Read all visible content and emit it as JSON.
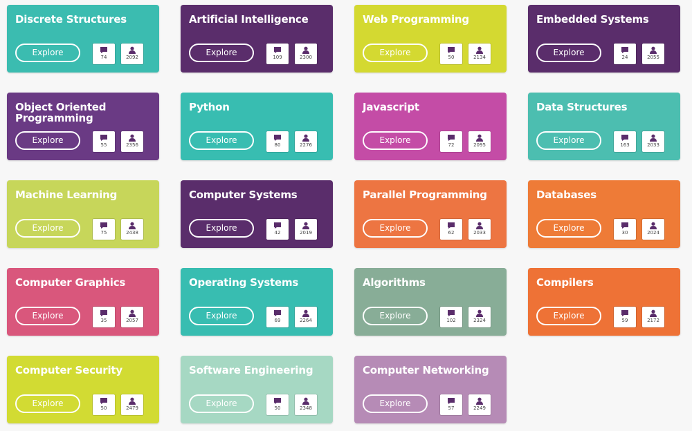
{
  "explore_label": "Explore",
  "cards": [
    {
      "title": "Discrete Structures",
      "color": "#3bbcb0",
      "comments": "74",
      "users": "2092"
    },
    {
      "title": "Artificial Intelligence",
      "color": "#5a2d6b",
      "comments": "109",
      "users": "2300"
    },
    {
      "title": "Web Programming",
      "color": "#d4d931",
      "comments": "50",
      "users": "2134"
    },
    {
      "title": "Embedded Systems",
      "color": "#5a2d6b",
      "comments": "24",
      "users": "2055"
    },
    {
      "title": "Object Oriented Programming",
      "color": "#6a3a84",
      "comments": "55",
      "users": "2356"
    },
    {
      "title": "Python",
      "color": "#38bdb1",
      "comments": "80",
      "users": "2276"
    },
    {
      "title": "Javascript",
      "color": "#c44ca6",
      "comments": "72",
      "users": "2095"
    },
    {
      "title": "Data Structures",
      "color": "#4cbeb0",
      "comments": "163",
      "users": "2033"
    },
    {
      "title": "Machine Learning",
      "color": "#c7d65a",
      "comments": "75",
      "users": "2438"
    },
    {
      "title": "Computer Systems",
      "color": "#5a2d6b",
      "comments": "42",
      "users": "2019"
    },
    {
      "title": "Parallel Programming",
      "color": "#ed7542",
      "comments": "62",
      "users": "2033"
    },
    {
      "title": "Databases",
      "color": "#ee7b37",
      "comments": "30",
      "users": "2024"
    },
    {
      "title": "Computer Graphics",
      "color": "#d9577c",
      "comments": "35",
      "users": "2057"
    },
    {
      "title": "Operating Systems",
      "color": "#38bdb1",
      "comments": "69",
      "users": "2264"
    },
    {
      "title": "Algorithms",
      "color": "#88ad97",
      "comments": "102",
      "users": "2324"
    },
    {
      "title": "Compilers",
      "color": "#ee7236",
      "comments": "59",
      "users": "2172"
    },
    {
      "title": "Computer Security",
      "color": "#d2db33",
      "comments": "50",
      "users": "2479"
    },
    {
      "title": "Software Engineering",
      "color": "#a6d8c3",
      "comments": "50",
      "users": "2348"
    },
    {
      "title": "Computer Networking",
      "color": "#b68bb6",
      "comments": "57",
      "users": "2249"
    }
  ]
}
